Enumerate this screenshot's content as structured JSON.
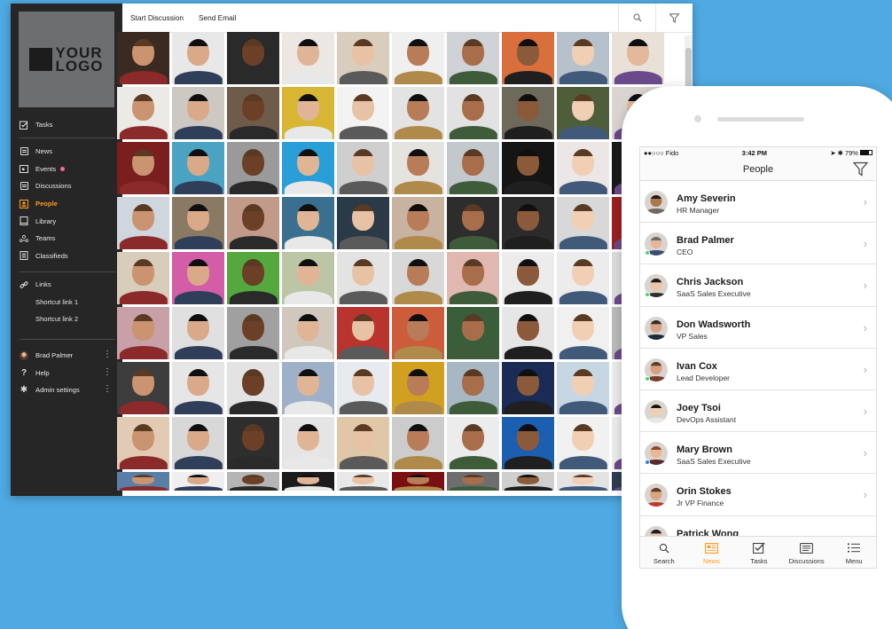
{
  "desktop": {
    "logo": {
      "line1": "YOUR",
      "line2": "LOGO"
    },
    "sidebar": {
      "top": [
        {
          "label": "Tasks",
          "icon": "tasks-icon"
        }
      ],
      "main": [
        {
          "label": "News",
          "icon": "news-icon",
          "active": false
        },
        {
          "label": "Events",
          "icon": "events-icon",
          "active": false,
          "badge": true
        },
        {
          "label": "Discussions",
          "icon": "discussions-icon",
          "active": false
        },
        {
          "label": "People",
          "icon": "people-icon",
          "active": true
        },
        {
          "label": "Library",
          "icon": "library-icon",
          "active": false
        },
        {
          "label": "Teams",
          "icon": "teams-icon",
          "active": false
        },
        {
          "label": "Classifieds",
          "icon": "classifieds-icon",
          "active": false
        }
      ],
      "links_label": "Links",
      "links": [
        "Shortcut link 1",
        "Shortcut link 2"
      ],
      "footer": [
        {
          "label": "Brad Palmer",
          "icon": "avatar"
        },
        {
          "label": "Help",
          "icon": "help-icon"
        },
        {
          "label": "Admin settings",
          "icon": "gear-icon"
        }
      ],
      "accent": "#ff9a1f",
      "background": "#262626"
    },
    "toolbar": {
      "start_discussion": "Start Discussion",
      "send_email": "Send Email",
      "search_icon": "search-icon",
      "filter_icon": "filter-icon"
    }
  },
  "mobile": {
    "status": {
      "carrier": "●●○○○ Fido",
      "time": "3:42 PM",
      "battery": "79%"
    },
    "title": "People",
    "people": [
      {
        "name": "Amy Severin",
        "title": "HR Manager",
        "online": false,
        "skin": "#a9774f",
        "hair": "#2a1810",
        "shirt": "#6e6a63"
      },
      {
        "name": "Brad Palmer",
        "title": "CEO",
        "online": true,
        "status_color": "#4cd964",
        "skin": "#e2b79a",
        "hair": "#6b6b6b",
        "shirt": "#3b4f73"
      },
      {
        "name": "Chris Jackson",
        "title": "SaaS Sales Executive",
        "online": true,
        "status_color": "#4cd964",
        "skin": "#e9c4a7",
        "hair": "#1b1b1b",
        "shirt": "#2d2d2d"
      },
      {
        "name": "Don Wadsworth",
        "title": "VP Sales",
        "online": false,
        "skin": "#d7a585",
        "hair": "#3a2b22",
        "shirt": "#1f2a3a"
      },
      {
        "name": "Ivan Cox",
        "title": "Lead Developer",
        "online": true,
        "status_color": "#4cd964",
        "skin": "#d9a07c",
        "hair": "#5c3d28",
        "shirt": "#7a3b2c"
      },
      {
        "name": "Joey Tsoi",
        "title": "DevOps Assistant",
        "online": false,
        "skin": "#efcfb2",
        "hair": "#161616",
        "shirt": "#e8e8e8"
      },
      {
        "name": "Mary Brown",
        "title": "SaaS Sales Executive",
        "online": true,
        "status_color": "#2f80ed",
        "skin": "#e8b793",
        "hair": "#8a4a2a",
        "shirt": "#5a2a2a"
      },
      {
        "name": "Orin Stokes",
        "title": "Jr VP Finance",
        "online": false,
        "skin": "#d6a784",
        "hair": "#6d3a24",
        "shirt": "#c0392b"
      },
      {
        "name": "Patrick Wong",
        "title": "",
        "online": false,
        "skin": "#e6c3a6",
        "hair": "#1c1c1c",
        "shirt": "#555555"
      }
    ],
    "tabs": [
      {
        "label": "Search",
        "icon": "search-icon",
        "active": false
      },
      {
        "label": "News",
        "icon": "news-icon",
        "active": true
      },
      {
        "label": "Tasks",
        "icon": "tasks-icon",
        "active": false
      },
      {
        "label": "Discussions",
        "icon": "discussions-icon",
        "active": false
      },
      {
        "label": "Menu",
        "icon": "menu-icon",
        "active": false
      }
    ]
  },
  "photo_grid": {
    "backgrounds": [
      "#3b2a22",
      "#e8e8e8",
      "#2a2a2a",
      "#ece7e2",
      "#d9cdbd",
      "#efefef",
      "#cfd2d6",
      "#d86f3c",
      "#b7c1cc",
      "#e9e1d8",
      "#eceae6",
      "#cdc9c2",
      "#6f5b4a",
      "#d8b634",
      "#f3f3f3",
      "#e3e3e3",
      "#e2e2e2",
      "#6d6a5c",
      "#4f5e3a",
      "#d9d4cf",
      "#7b1e1e",
      "#4aa3c2",
      "#9a9a9a",
      "#2a9ed6",
      "#cfcfcf",
      "#e5e3df",
      "#c3c8cc",
      "#151515",
      "#ece6e6",
      "#1a1a1a",
      "#cfd6dd",
      "#8a7a63",
      "#c29a8a",
      "#3b6f8f",
      "#2b3a47",
      "#c8b2a0",
      "#2d2d2d",
      "#2b2b2b",
      "#d8d8d8",
      "#9b2020",
      "#d8ccba",
      "#d45da8",
      "#55a83d",
      "#bcc6a6",
      "#e3e3e3",
      "#d8d8d8",
      "#e0b8b0",
      "#ececec",
      "#ececec",
      "#dcdcdc",
      "#c8a0a8",
      "#e0e0e0",
      "#a0a0a0",
      "#d0c8bd",
      "#b9342e",
      "#cc5c3a",
      "#3b5e3a",
      "#e6e6e6",
      "#f0f0f0",
      "#b9b9b9",
      "#3d3d3d",
      "#e6e6e6",
      "#e3e3e3",
      "#9fb1c9",
      "#e7ebef",
      "#d2a020",
      "#a8b7c4",
      "#1a2b55",
      "#c6d6e2",
      "#ebebeb",
      "#e2cab5",
      "#d8d8d8",
      "#2e2e2e",
      "#e5e5e5",
      "#e0c7a8",
      "#cccccc",
      "#ececec",
      "#1c5fb0",
      "#f1f1f1",
      "#ececec",
      "#5a7fa6",
      "#efefef",
      "#b5b5b5",
      "#1b1b1b",
      "#e8e8e8",
      "#7a0f12",
      "#6e6e6e",
      "#cfcfcf",
      "#e3e3e3",
      "#2d3d52"
    ],
    "skins": [
      "#e0b596",
      "#c9946f",
      "#8a5a3b",
      "#e8c2a5",
      "#d9a98a",
      "#f0cfb5",
      "#b97c58",
      "#6b4027",
      "#e3b99c",
      "#a86e4b"
    ],
    "hairs": [
      "#1f1a16",
      "#3a2a1e",
      "#5a3a22",
      "#141414",
      "#7a5230",
      "#2a2a2a",
      "#9c7650",
      "#0f0f0f",
      "#4a3526",
      "#bfa27f"
    ],
    "shirts": [
      "#2f3e59",
      "#5a5a5a",
      "#1f1f1f",
      "#8a2a2a",
      "#e8e8e8",
      "#3e5c3a",
      "#6a4a8a",
      "#2a2a2a",
      "#b08a4a",
      "#415a7a"
    ]
  }
}
